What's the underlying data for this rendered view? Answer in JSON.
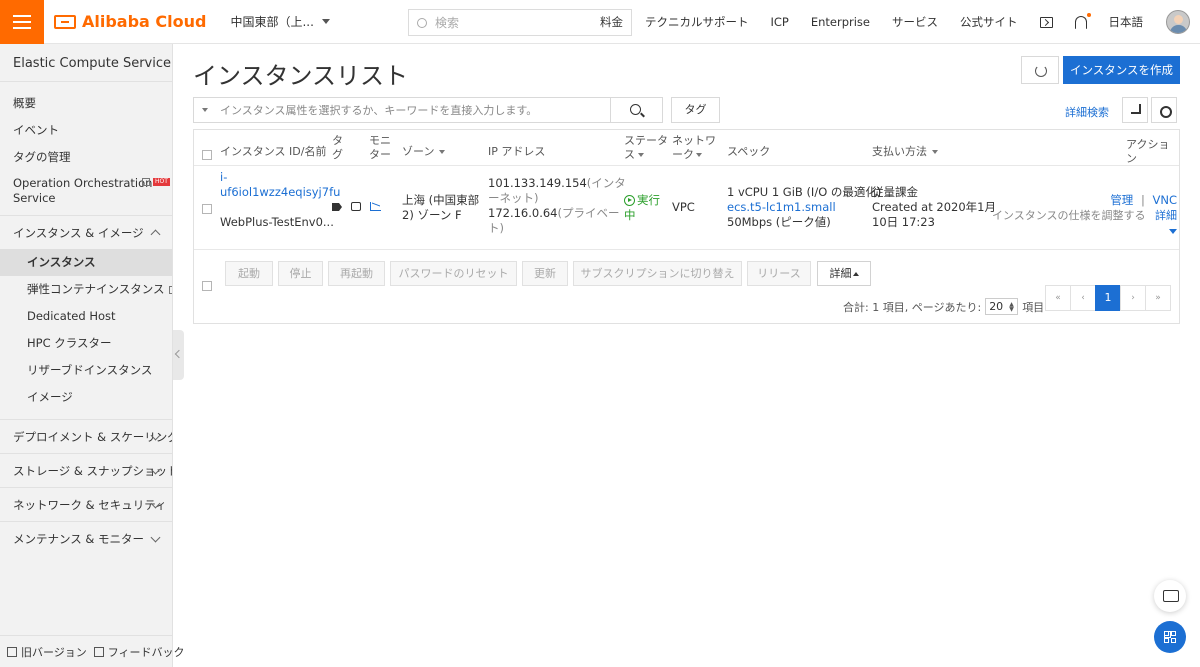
{
  "topbar": {
    "logo_text": "Alibaba Cloud",
    "region": "中国東部（上...",
    "search_placeholder": "検索",
    "links": [
      "料金",
      "テクニカルサポート",
      "ICP",
      "Enterprise",
      "サービス",
      "公式サイト"
    ],
    "language": "日本語"
  },
  "sidebar": {
    "title": "Elastic Compute Service (E···",
    "items_top": [
      {
        "label": "概要"
      },
      {
        "label": "イベント"
      },
      {
        "label": "タグの管理"
      }
    ],
    "orchestration_label": "Operation Orchestration Service",
    "hot_badge": "HOT",
    "group_instances": "インスタンス & イメージ",
    "sub_items": [
      {
        "label": "インスタンス",
        "active": true
      },
      {
        "label": "弾性コンテナインスタンス",
        "external": true
      },
      {
        "label": "Dedicated Host"
      },
      {
        "label": "HPC クラスター"
      },
      {
        "label": "リザーブドインスタンス"
      },
      {
        "label": "イメージ"
      }
    ],
    "groups": [
      "デプロイメント & スケーリング",
      "ストレージ & スナップショット",
      "ネットワーク & セキュリティ",
      "メンテナンス & モニター"
    ],
    "footer": {
      "old_version": "旧バージョン",
      "feedback": "フィードバック"
    }
  },
  "main": {
    "title": "インスタンスリスト",
    "create_button": "インスタンスを作成",
    "filter_placeholder": "インスタンス属性を選択するか、キーワードを直接入力します。",
    "tag_button": "タグ",
    "advanced_search": "詳細検索",
    "table": {
      "headers": {
        "id": "インスタンス ID/名前",
        "tag": "タ\nグ",
        "monitor": "モニ\nター",
        "zone": "ゾーン",
        "ip": "IP アドレス",
        "status": "ステータ\nス",
        "network": "ネットワ\nーク",
        "spec": "スペック",
        "billing": "支払い方法",
        "action": "アクション"
      },
      "rows": [
        {
          "id_line1": "i-",
          "id_line2": "uf6iol1wzz4eqisyj7fu",
          "name": "WebPlus-TestEnv0...",
          "zone_line1": "上海 (中国東部",
          "zone_line2": "2) ゾーン F",
          "ip_public": "101.133.149.154",
          "ip_public_suffix1": "(インタ",
          "ip_public_suffix2": "ーネット)",
          "ip_private": "172.16.0.64",
          "ip_private_suffix1": "(プライベー",
          "ip_private_suffix2": "ト)",
          "status_line1": "実行",
          "status_line2": "中",
          "network": "VPC",
          "spec_line1": "1 vCPU 1 GiB (I/O の最適化)",
          "spec_type": "ecs.t5-lc1m1.small",
          "spec_bandwidth": "50Mbps (ピーク値)",
          "billing_line1": "従量課金",
          "billing_line2": "Created at 2020年1月",
          "billing_line3": "10日 17:23",
          "action_manage": "管理",
          "action_sep": "|",
          "action_vnc": "VNC",
          "action_adjust": "インスタンスの仕様を調整する",
          "action_more": "詳細"
        }
      ]
    },
    "bulk_buttons": [
      "起動",
      "停止",
      "再起動",
      "パスワードのリセット",
      "更新",
      "サブスクリプションに切り替え",
      "リリース"
    ],
    "bulk_more": "詳細",
    "pagination": {
      "total_text": "合計: 1 項目, ページあたり:",
      "page_size": "20",
      "items_suffix": "項目",
      "first": "«",
      "prev": "‹",
      "current": "1",
      "next": "›",
      "last": "»"
    }
  },
  "colors": {
    "brand": "#ff6a00",
    "primary": "#1c6fd3",
    "running": "#2b9f2b"
  }
}
